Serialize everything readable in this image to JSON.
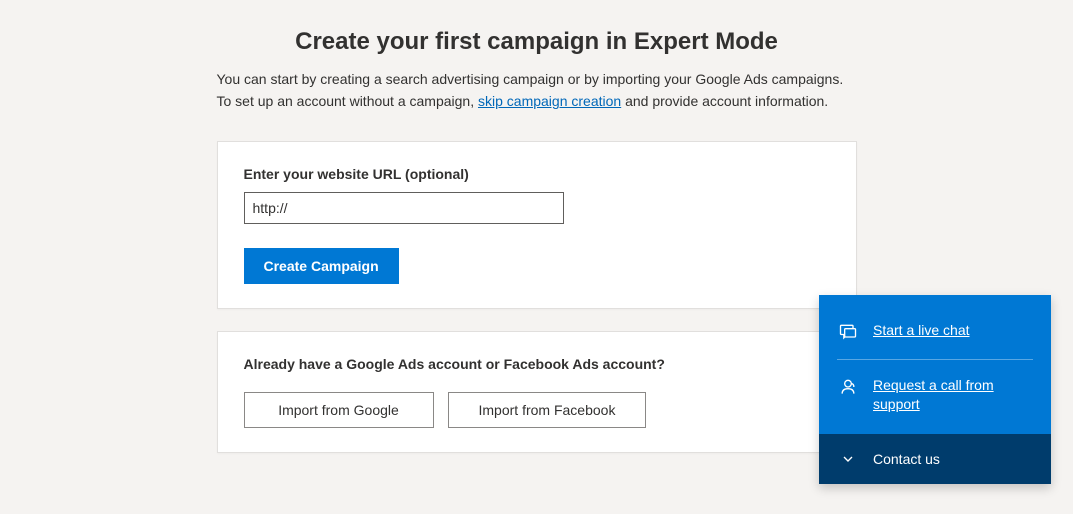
{
  "header": {
    "title": "Create your first campaign in Expert Mode",
    "intro_pre": "You can start by creating a search advertising campaign or by importing your Google Ads campaigns. To set up an account without a campaign, ",
    "skip_link": "skip campaign creation",
    "intro_post": " and provide account information."
  },
  "url_card": {
    "label": "Enter your website URL (optional)",
    "value": "http://",
    "create_btn": "Create Campaign"
  },
  "import_card": {
    "question": "Already have a Google Ads account or Facebook Ads account?",
    "google_btn": "Import from Google",
    "facebook_btn": "Import from Facebook"
  },
  "support": {
    "live_chat": "Start a live chat",
    "request_call": "Request a call from support",
    "contact": "Contact us"
  }
}
